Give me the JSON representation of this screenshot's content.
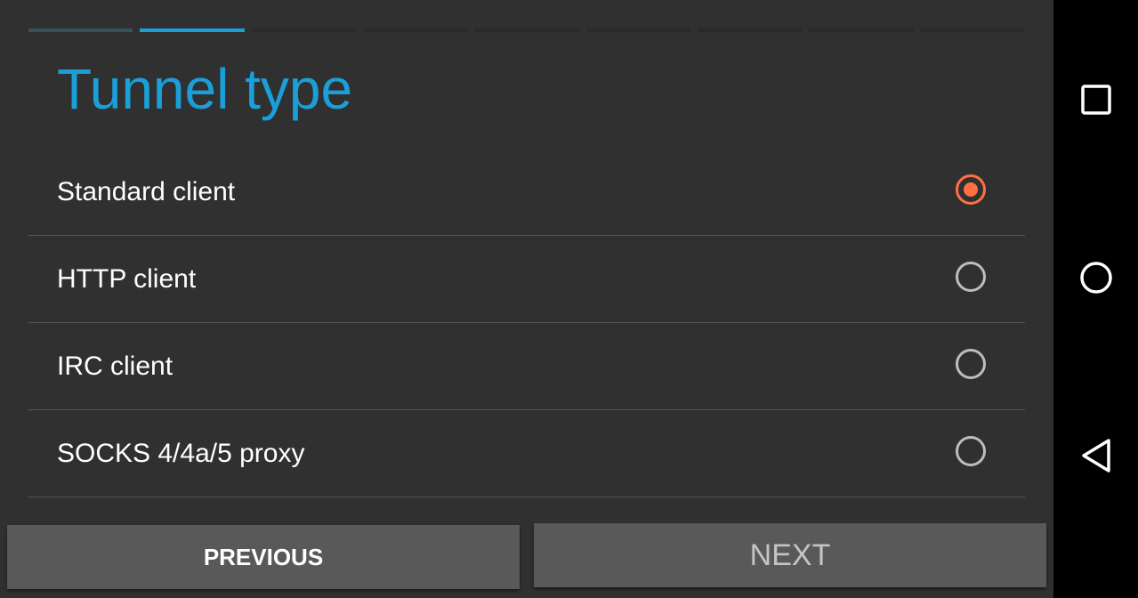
{
  "wizard": {
    "progress": {
      "total_steps": 9,
      "current_step": 2
    },
    "title": "Tunnel type",
    "options": [
      {
        "label": "Standard client",
        "selected": true
      },
      {
        "label": "HTTP client",
        "selected": false
      },
      {
        "label": "IRC client",
        "selected": false
      },
      {
        "label": "SOCKS 4/4a/5 proxy",
        "selected": false
      }
    ],
    "buttons": {
      "previous_label": "PREVIOUS",
      "next_label": "NEXT"
    }
  },
  "colors": {
    "accent": "#1a9fd8",
    "radio_selected": "#ff7043",
    "background": "#303030"
  },
  "system_nav": {
    "icons": [
      "recents-square-icon",
      "home-circle-icon",
      "back-triangle-icon"
    ]
  }
}
